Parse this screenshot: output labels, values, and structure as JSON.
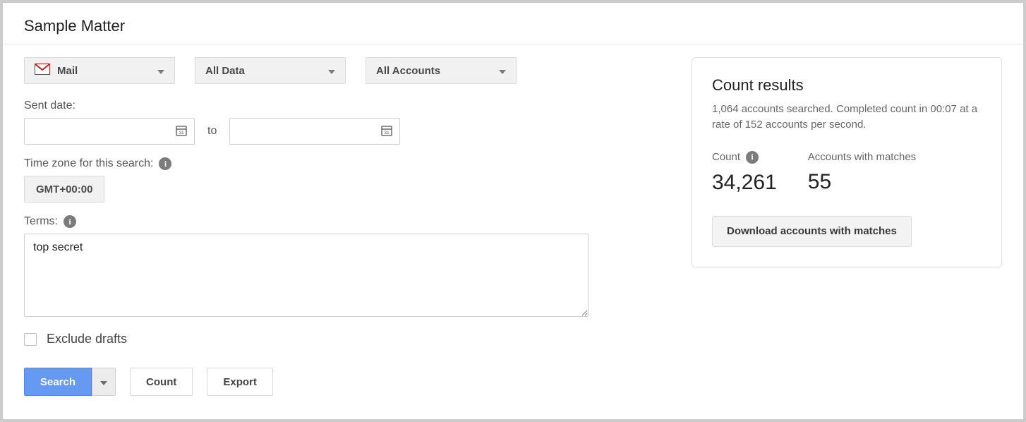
{
  "page": {
    "title": "Sample Matter"
  },
  "dropdowns": {
    "service": "Mail",
    "data_scope": "All Data",
    "account_scope": "All Accounts"
  },
  "labels": {
    "sent_date": "Sent date:",
    "date_to": "to",
    "timezone": "Time zone for this search:",
    "terms": "Terms:",
    "exclude_drafts": "Exclude drafts"
  },
  "values": {
    "timezone": "GMT+00:00",
    "terms": "top secret",
    "date_from": "",
    "date_to": ""
  },
  "buttons": {
    "search": "Search",
    "count": "Count",
    "export": "Export"
  },
  "results": {
    "title": "Count results",
    "summary": "1,064 accounts searched. Completed count in 00:07 at a rate of 152 accounts per second.",
    "count_label": "Count",
    "count_value": "34,261",
    "matches_label": "Accounts with matches",
    "matches_value": "55",
    "download_label": "Download accounts with matches"
  }
}
